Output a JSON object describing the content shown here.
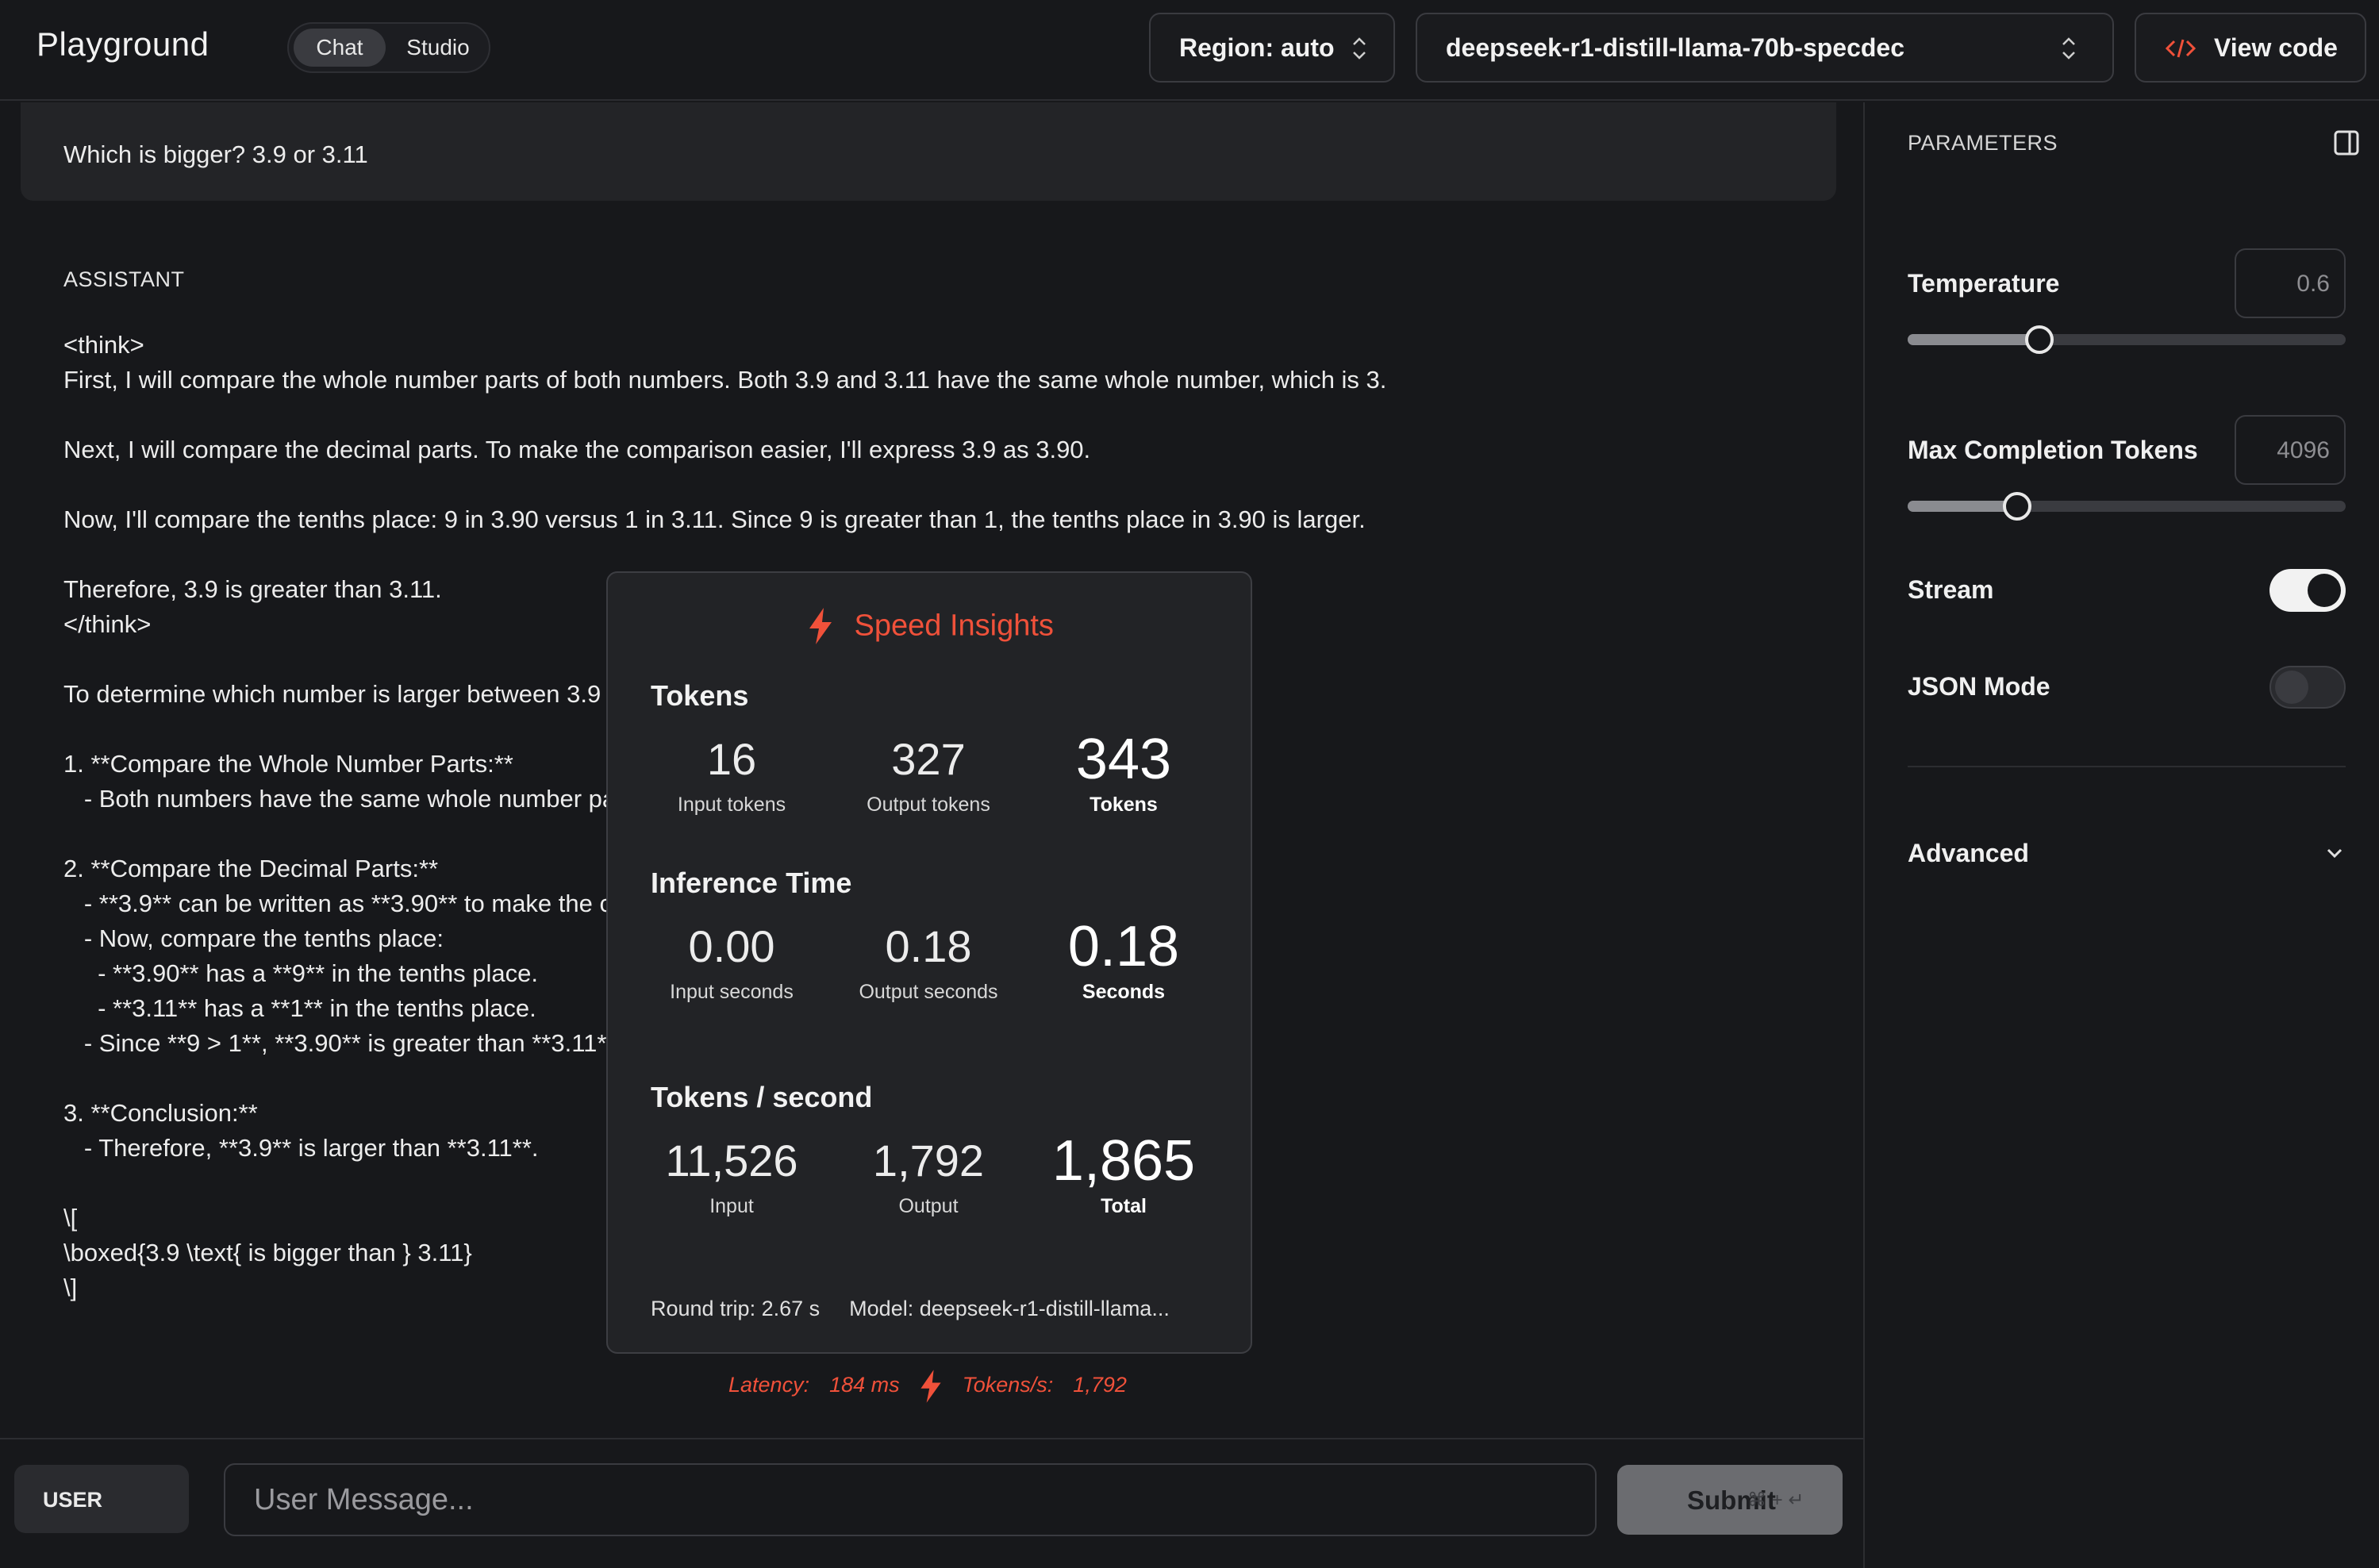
{
  "header": {
    "app_title": "Playground",
    "tabs": [
      {
        "label": "Chat",
        "active": true
      },
      {
        "label": "Studio",
        "active": false
      }
    ],
    "region_label": "Region: auto",
    "model_label": "deepseek-r1-distill-llama-70b-specdec",
    "view_code_label": "View code"
  },
  "conversation": {
    "user_message": "Which is bigger? 3.9 or 3.11",
    "assistant_role": "ASSISTANT",
    "assistant_text": "<think>\nFirst, I will compare the whole number parts of both numbers. Both 3.9 and 3.11 have the same whole number, which is 3.\n\nNext, I will compare the decimal parts. To make the comparison easier, I'll express 3.9 as 3.90.\n\nNow, I'll compare the tenths place: 9 in 3.90 versus 1 in 3.11. Since 9 is greater than 1, the tenths place in 3.90 is larger.\n\nTherefore, 3.9 is greater than 3.11.\n</think>\n\nTo determine which number is larger between 3.9 and 3.11, follow these steps:\n\n1. **Compare the Whole Number Parts:**\n   - Both numbers have the same whole number part, which is 3.\n\n2. **Compare the Decimal Parts:**\n   - **3.9** can be written as **3.90** to make the comparison easier.\n   - Now, compare the tenths place:\n     - **3.90** has a **9** in the tenths place.\n     - **3.11** has a **1** in the tenths place.\n   - Since **9 > 1**, **3.90** is greater than **3.11**.\n\n3. **Conclusion:**\n   - Therefore, **3.9** is larger than **3.11**.\n\n\\[\n\\boxed{3.9 \\text{ is bigger than } 3.11}\n\\]"
  },
  "speed_insights": {
    "title": "Speed Insights",
    "tokens": {
      "heading": "Tokens",
      "input": "16",
      "input_label": "Input tokens",
      "output": "327",
      "output_label": "Output tokens",
      "total": "343",
      "total_label": "Tokens"
    },
    "inference_time": {
      "heading": "Inference Time",
      "input": "0.00",
      "input_label": "Input seconds",
      "output": "0.18",
      "output_label": "Output seconds",
      "total": "0.18",
      "total_label": "Seconds"
    },
    "tokens_per_second": {
      "heading": "Tokens / second",
      "input": "11,526",
      "input_label": "Input",
      "output": "1,792",
      "output_label": "Output",
      "total": "1,865",
      "total_label": "Total"
    },
    "round_trip": "Round trip: 2.67 s",
    "model": "Model: deepseek-r1-distill-llama..."
  },
  "latency_bar": {
    "latency_label": "Latency:",
    "latency_value": "184 ms",
    "tps_label": "Tokens/s:",
    "tps_value": "1,792"
  },
  "input_bar": {
    "role": "USER",
    "placeholder": "User Message...",
    "submit_label": "Submit",
    "shortcut": "⌘ + ↵"
  },
  "parameters": {
    "title": "PARAMETERS",
    "temperature": {
      "label": "Temperature",
      "value": "0.6",
      "slider_fraction": 0.3
    },
    "max_tokens": {
      "label": "Max Completion Tokens",
      "value": "4096",
      "slider_fraction": 0.25
    },
    "stream": {
      "label": "Stream",
      "on": true
    },
    "json_mode": {
      "label": "JSON Mode",
      "on": false
    },
    "advanced_label": "Advanced"
  },
  "colors": {
    "accent": "#f0513a",
    "background": "#17181b",
    "panel": "#222326"
  }
}
